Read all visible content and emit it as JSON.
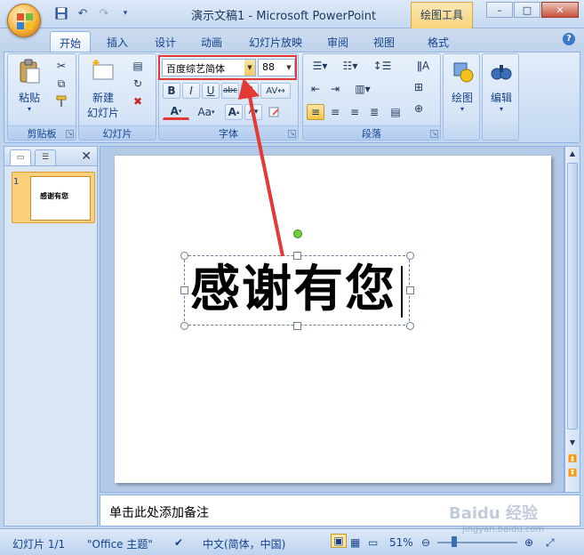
{
  "window": {
    "title": "演示文稿1 - Microsoft PowerPoint",
    "context_tab_title": "绘图工具",
    "controls": {
      "minimize": "–",
      "maximize": "□",
      "close": "✕"
    }
  },
  "quick_access": {
    "save_icon": "save-icon",
    "undo_icon": "undo-icon",
    "redo_icon": "redo-icon",
    "customize_icon": "chevron-down-icon"
  },
  "tabs": [
    "开始",
    "插入",
    "设计",
    "动画",
    "幻灯片放映",
    "审阅",
    "视图",
    "格式"
  ],
  "active_tab": "开始",
  "ribbon": {
    "clipboard": {
      "label": "剪贴板",
      "paste": "粘贴"
    },
    "slides": {
      "label": "幻灯片",
      "new_slide_line1": "新建",
      "new_slide_line2": "幻灯片"
    },
    "font": {
      "label": "字体",
      "font_name": "百度综艺简体",
      "font_size": "88",
      "bold": "B",
      "italic": "I",
      "underline": "U",
      "strike": "abc",
      "shadow": "S",
      "font_color": "A",
      "change_case": "Aa",
      "grow": "A"
    },
    "paragraph": {
      "label": "段落"
    },
    "drawing": {
      "label": "绘图"
    },
    "editing": {
      "label": "编辑"
    }
  },
  "slides_pane": {
    "slide_number": "1",
    "thumb_text": "感谢有您",
    "close_label": "✕"
  },
  "slide": {
    "text": "感谢有您"
  },
  "notes": {
    "placeholder": "单击此处添加备注"
  },
  "statusbar": {
    "slide_info": "幻灯片 1/1",
    "theme": "\"Office 主题\"",
    "language": "中文(简体，中国)",
    "zoom": "51%"
  },
  "watermark": {
    "brand": "Baidu 经验",
    "url": "jingyan.baidu.com"
  },
  "colors": {
    "highlight": "#e53935",
    "accent": "#15428b"
  }
}
